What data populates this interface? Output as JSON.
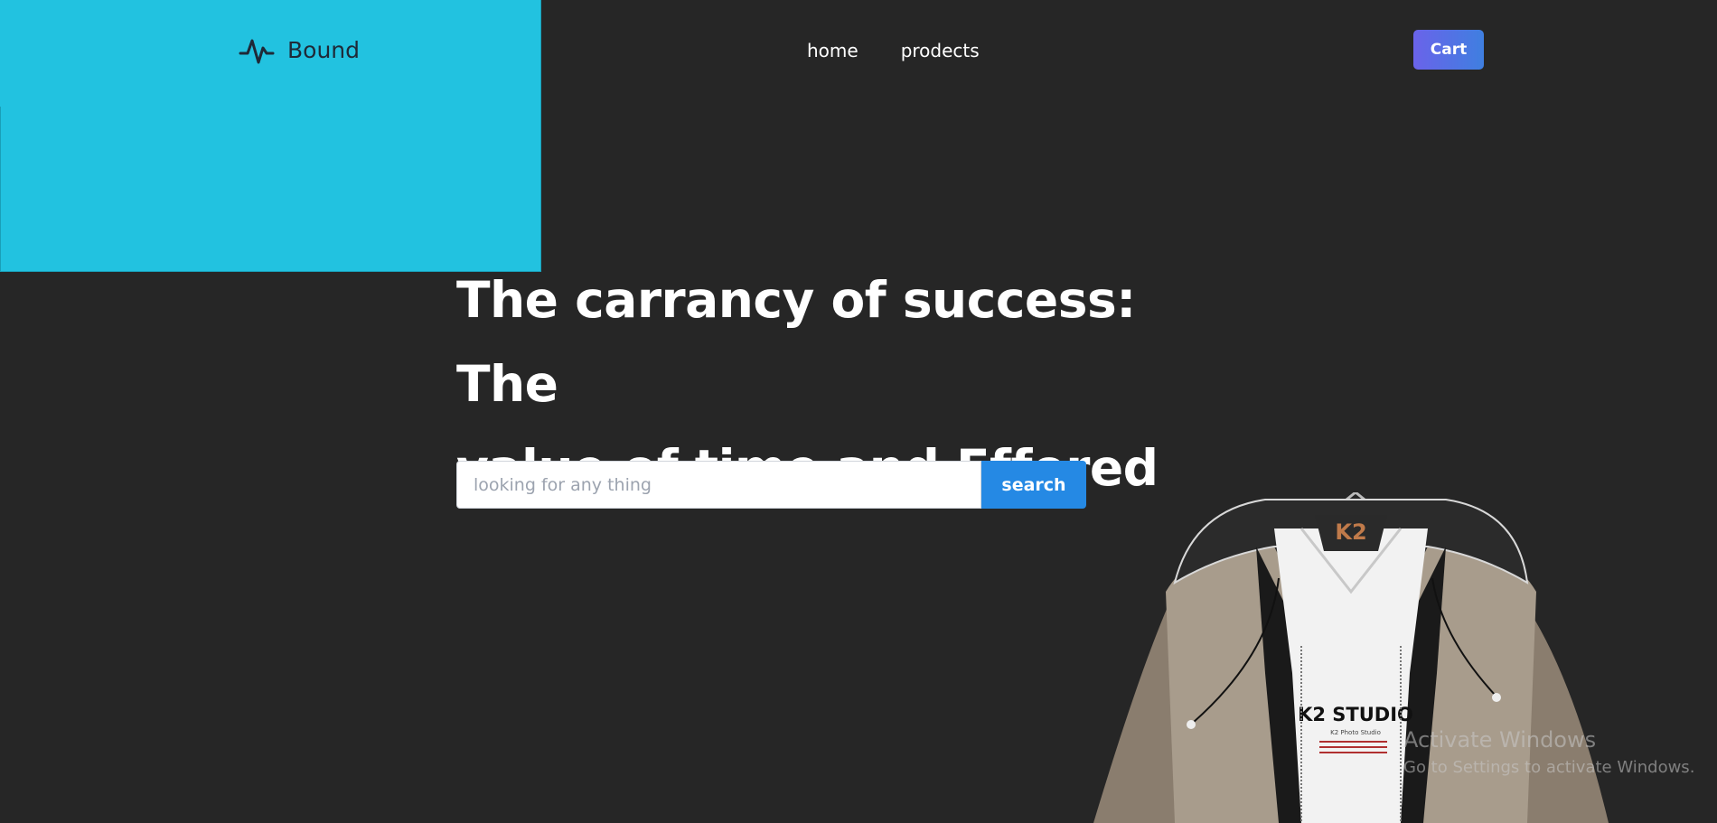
{
  "brand": {
    "name": "Bound",
    "logo_icon": "pulse-icon"
  },
  "nav": {
    "items": [
      {
        "label": "home"
      },
      {
        "label": "prodects"
      }
    ]
  },
  "cart": {
    "label": "Cart"
  },
  "hero": {
    "title_line1": "The carrancy of success: The",
    "title_line2": "value of time and Effored"
  },
  "search": {
    "placeholder": "looking for any thing",
    "value": "",
    "button_label": "search"
  },
  "product_image": {
    "label_top": "K2",
    "label_chest": "K2 STUDIO",
    "label_small": "K2 Photo Studio"
  },
  "watermark": {
    "title": "Activate Windows",
    "subtitle": "Go to Settings to activate Windows."
  },
  "colors": {
    "background": "#262626",
    "accent_cyan": "#22c2e0",
    "cart_gradient_start": "#6a63ea",
    "cart_gradient_end": "#3f7fe0",
    "search_button": "#2589e4"
  }
}
